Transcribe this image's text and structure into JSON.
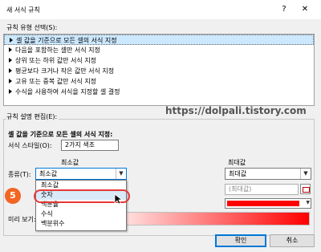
{
  "window": {
    "title": "새 서식 규칙",
    "help_label": "?",
    "close_label": "✕"
  },
  "rule_type": {
    "label": "규칙 유형 선택(S):",
    "items": [
      {
        "label": "셀 값을 기준으로 모든 셀의 서식 지정",
        "selected": true
      },
      {
        "label": "다음을 포함하는 셀만 서식 지정"
      },
      {
        "label": "상위 또는 하위 값만 서식 지정"
      },
      {
        "label": "평균보다 크거나 작은 값만 서식 지정"
      },
      {
        "label": "고유 또는 중복 값만 서식 지정"
      },
      {
        "label": "수식을 사용하여 서식을 지정할 셀 결정"
      }
    ]
  },
  "watermark": "https://dolpali.tistory.com",
  "edit": {
    "label": "규칙 설명 편집(E):",
    "title": "셀 값을 기준으로 모든 셀의 서식 지정:",
    "style_label": "서식 스타일(O):",
    "style_value": "2가지 색조",
    "min_header": "최소값",
    "max_header": "최대값",
    "type_label": "종류(T):",
    "min_type_value": "최소값",
    "max_type_value": "최대값",
    "max_value_placeholder": "(최대값)",
    "max_color": "#ff0000",
    "preview_label": "미리 보기:"
  },
  "dropdown": {
    "items": [
      {
        "label": "최소값"
      },
      {
        "label": "숫자",
        "selected": true
      },
      {
        "label": "백분율"
      },
      {
        "label": "수식"
      },
      {
        "label": "백분위수"
      }
    ]
  },
  "step_badge": "5",
  "buttons": {
    "ok": "확인",
    "cancel": "취소"
  }
}
